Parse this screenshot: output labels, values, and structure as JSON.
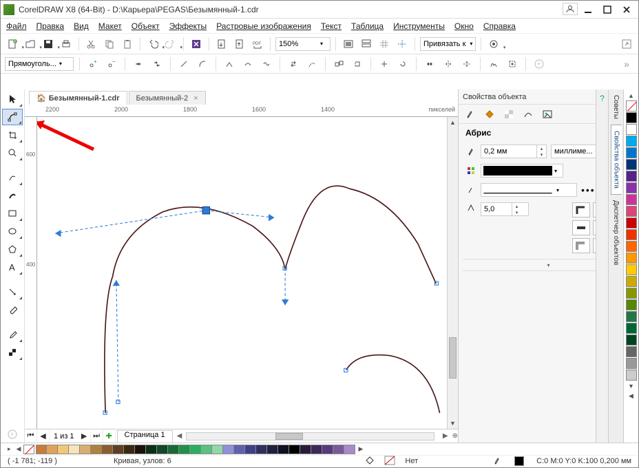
{
  "title": "CorelDRAW X8 (64-Bit) - D:\\Карьера\\PEGAS\\Безымянный-1.cdr",
  "menus": [
    "Файл",
    "Правка",
    "Вид",
    "Макет",
    "Объект",
    "Эффекты",
    "Растровые изображения",
    "Текст",
    "Таблица",
    "Инструменты",
    "Окно",
    "Справка"
  ],
  "toolbar": {
    "zoom": "150%",
    "snap_label": "Привязать к"
  },
  "propbar": {
    "shape_mode": "Прямоуголь..."
  },
  "tabs": [
    {
      "label": "Безымянный-1.cdr",
      "active": true
    },
    {
      "label": "Безымянный-2",
      "active": false
    }
  ],
  "ruler": {
    "units": "пикселей",
    "top_ticks": [
      "2200",
      "2000",
      "1800",
      "1600",
      "1400"
    ],
    "left_ticks": [
      "600",
      "400"
    ]
  },
  "pager": {
    "of_label": "1  из  1",
    "page_tab": "Страница 1"
  },
  "docker": {
    "title": "Свойства объекта",
    "section": "Абрис",
    "outline_width": "0,2 мм",
    "units": "миллиме...",
    "miter": "5,0"
  },
  "side_tabs": [
    "Советы",
    "Свойства объекта",
    "Диспетчер объектов"
  ],
  "palette_colors": [
    "#000000",
    "#ffffff",
    "#00aaee",
    "#0077cc",
    "#003377",
    "#552288",
    "#8833aa",
    "#cc3399",
    "#dd4477",
    "#cc0000",
    "#ee3300",
    "#ff6600",
    "#ff9900",
    "#ffcc00",
    "#ccaa00",
    "#889900",
    "#558800",
    "#227744",
    "#006633",
    "#004422"
  ],
  "palette_h_colors": [
    "#c97b3c",
    "#e0a25a",
    "#f0c878",
    "#f8e4b8",
    "#d6b070",
    "#b08040",
    "#886030",
    "#604020",
    "#3a2810",
    "#1a1208",
    "#0a3018",
    "#104828",
    "#186838",
    "#209048",
    "#28b060",
    "#5cc080",
    "#90d8a8",
    "#9090d8",
    "#6060b0",
    "#404088",
    "#303060",
    "#202040",
    "#101020",
    "#000000"
  ],
  "status": {
    "coord": "( -1 781; -119  )",
    "object": "Кривая, узлов: 6",
    "fill_label": "Нет",
    "outline_info": "C:0 M:0 Y:0 K:100  0,200 мм"
  }
}
